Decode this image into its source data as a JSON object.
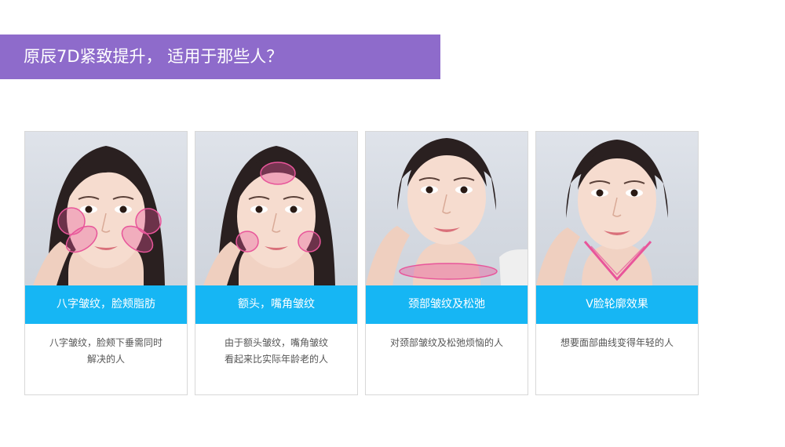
{
  "header": {
    "title": "原辰7D紧致提升， 适用于那些人？"
  },
  "colors": {
    "title_bg": "#8e6bcb",
    "label_bg": "#16b6f4",
    "highlight": "#e8559a"
  },
  "cards": [
    {
      "label": "八字皱纹，脸颊脂肪",
      "desc_lines": [
        "八字皱纹，脸颊下垂需同时",
        "解决的人"
      ]
    },
    {
      "label": "额头，嘴角皱纹",
      "desc_lines": [
        "由于额头皱纹，嘴角皱纹",
        "看起来比实际年龄老的人"
      ]
    },
    {
      "label": "颈部皱纹及松弛",
      "desc_lines": [
        "对颈部皱纹及松弛烦恼的人"
      ]
    },
    {
      "label": "V脸轮廓效果",
      "desc_lines": [
        "想要面部曲线变得年轻的人"
      ]
    }
  ]
}
